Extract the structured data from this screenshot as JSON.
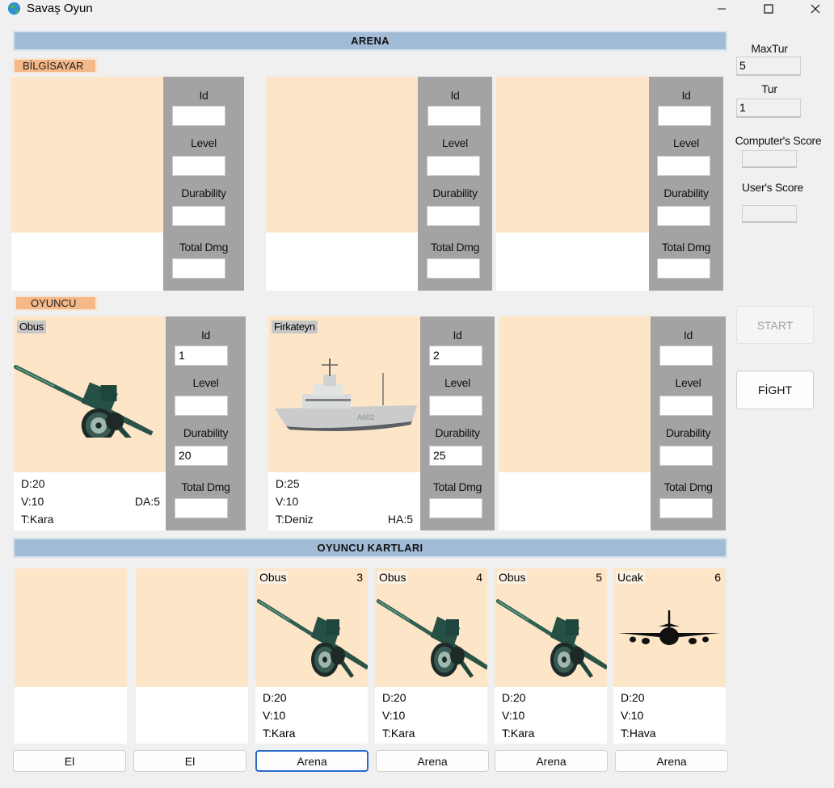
{
  "window": {
    "title": "Savaş Oyun"
  },
  "arena_header": "ARENA",
  "computer": {
    "label": "BİLGİSAYAR",
    "slots": [
      {
        "fields": {
          "id": "",
          "level": "",
          "durability": "",
          "total_dmg": ""
        }
      },
      {
        "fields": {
          "id": "",
          "level": "",
          "durability": "",
          "total_dmg": ""
        }
      },
      {
        "fields": {
          "id": "",
          "level": "",
          "durability": "",
          "total_dmg": ""
        }
      }
    ]
  },
  "field_labels": {
    "id": "Id",
    "level": "Level",
    "durability": "Durability",
    "total_dmg": "Total Dmg"
  },
  "player": {
    "label": "OYUNCU",
    "slots": [
      {
        "name": "Obus",
        "image": "howitzer-icon",
        "fields": {
          "id": "1",
          "level": "",
          "durability": "20",
          "total_dmg": ""
        },
        "stats": {
          "d": "D:20",
          "v": "V:10",
          "t": "T:Kara",
          "bonus": "DA:5"
        }
      },
      {
        "name": "Firkateyn",
        "image": "frigate-icon",
        "fields": {
          "id": "2",
          "level": "",
          "durability": "25",
          "total_dmg": ""
        },
        "stats": {
          "d": "D:25",
          "v": "V:10",
          "t": "T:Deniz",
          "bonus": "HA:5"
        }
      },
      {
        "fields": {
          "id": "",
          "level": "",
          "durability": "",
          "total_dmg": ""
        }
      }
    ]
  },
  "sidebar": {
    "max_tur_label": "MaxTur",
    "max_tur_value": "5",
    "tur_label": "Tur",
    "tur_value": "1",
    "computer_score_label": "Computer's Score",
    "computer_score_value": "",
    "user_score_label": "User's Score",
    "user_score_value": "",
    "start_label": "START",
    "fight_label": "FİGHT"
  },
  "cards_header": "OYUNCU KARTLARI",
  "hand": [
    {
      "button": "El"
    },
    {
      "button": "El"
    },
    {
      "name": "Obus",
      "num": "3",
      "image": "howitzer-icon",
      "d": "D:20",
      "v": "V:10",
      "t": "T:Kara",
      "button": "Arena"
    },
    {
      "name": "Obus",
      "num": "4",
      "image": "howitzer-icon",
      "d": "D:20",
      "v": "V:10",
      "t": "T:Kara",
      "button": "Arena"
    },
    {
      "name": "Obus",
      "num": "5",
      "image": "howitzer-icon",
      "d": "D:20",
      "v": "V:10",
      "t": "T:Kara",
      "button": "Arena"
    },
    {
      "name": "Ucak",
      "num": "6",
      "image": "airplane-icon",
      "d": "D:20",
      "v": "V:10",
      "t": "T:Hava",
      "button": "Arena"
    }
  ]
}
